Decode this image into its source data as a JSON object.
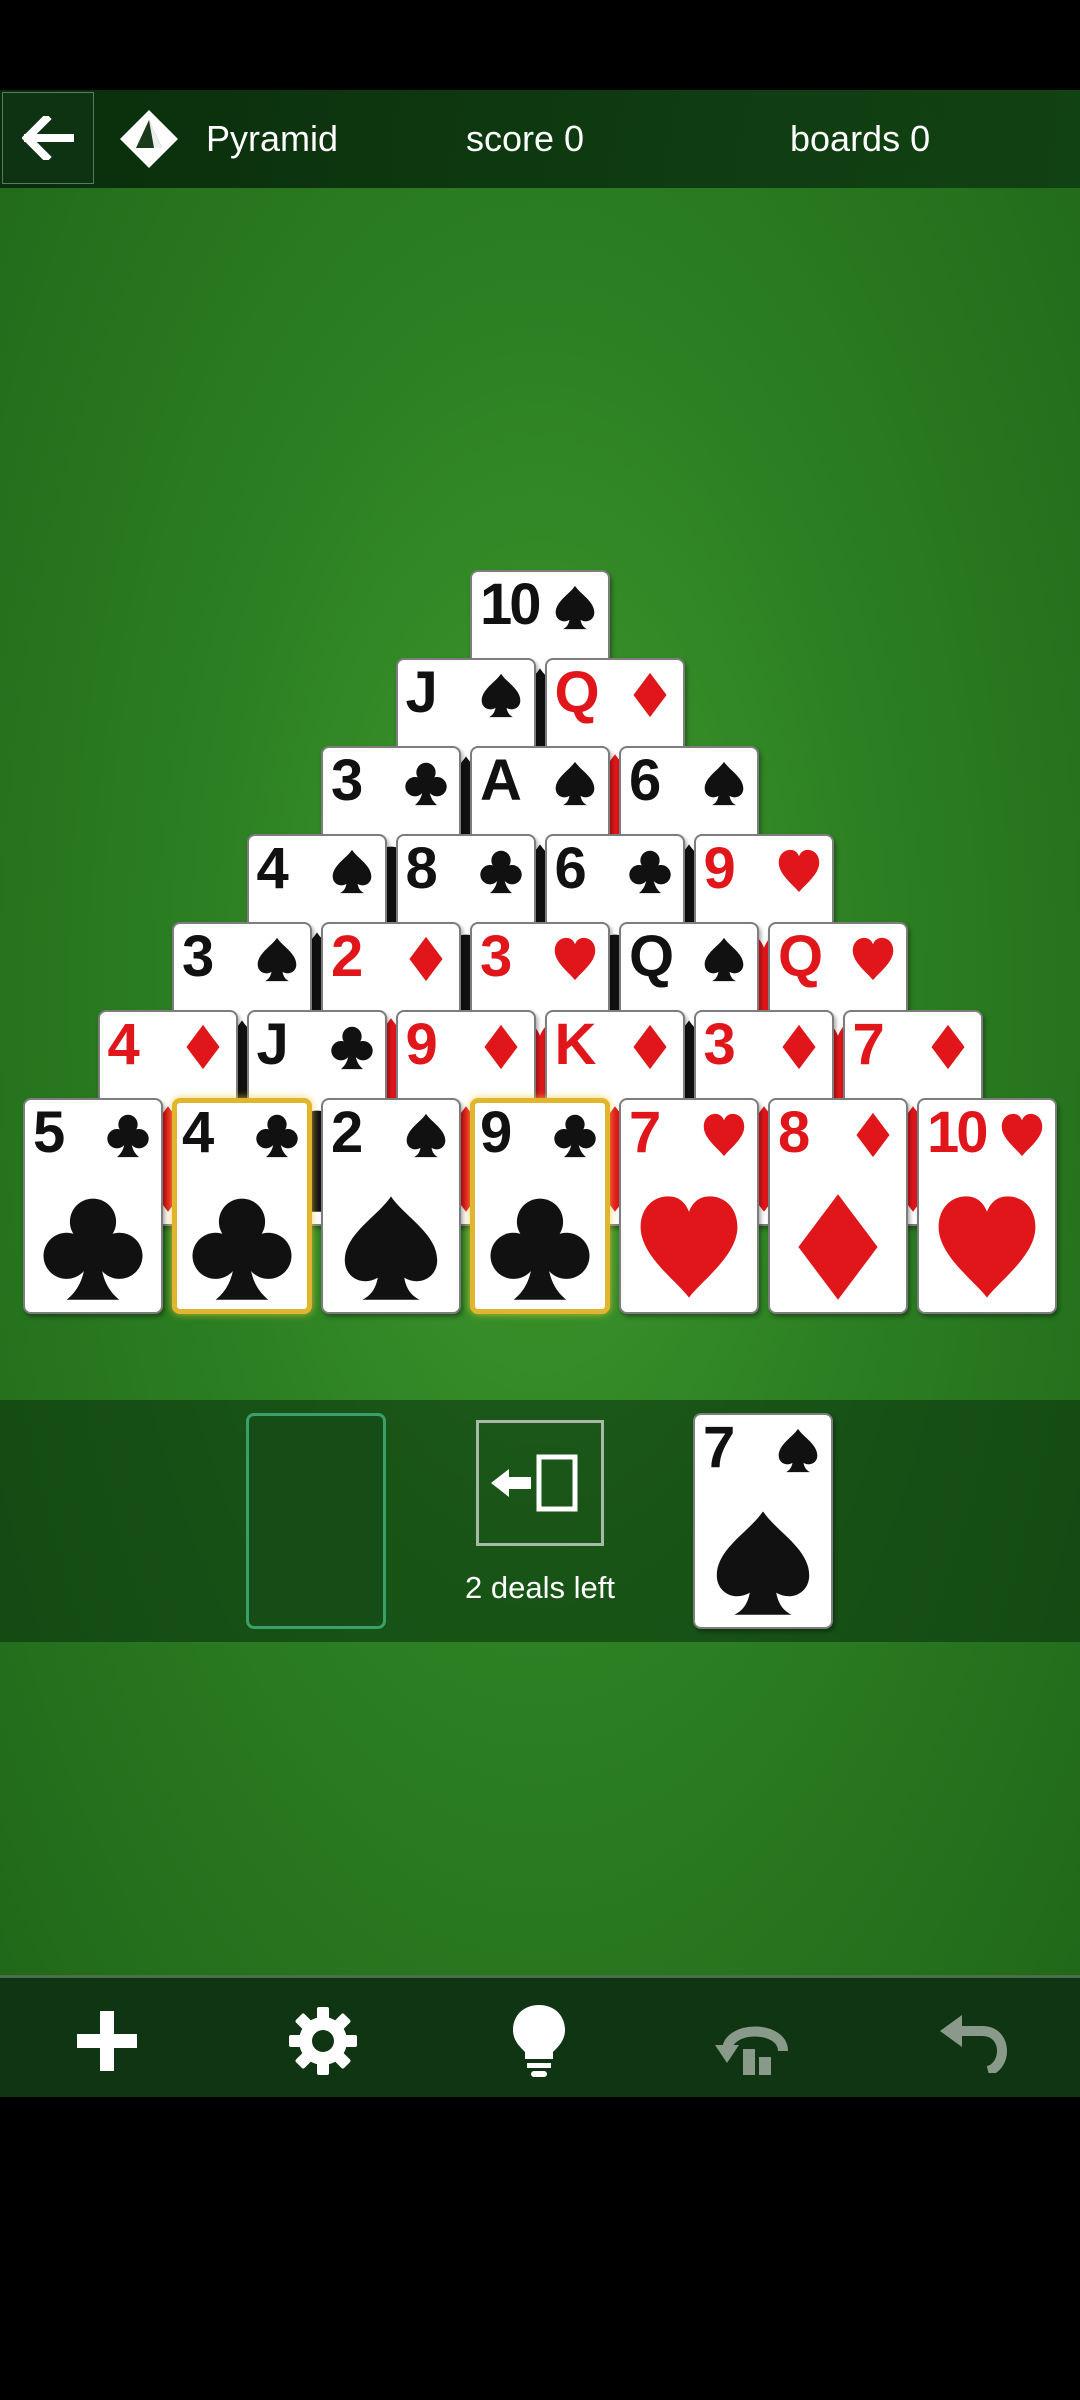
{
  "header": {
    "title": "Pyramid",
    "score": "score 0",
    "boards": "boards 0"
  },
  "colors": {
    "felt": "#2c7f22",
    "header": "#0d3313",
    "red_suit": "#e0161b",
    "black_suit": "#111111",
    "selected_border": "#e2b52f",
    "stock_outline": "#3aa06a"
  },
  "pyramid_rows": [
    [
      {
        "rank": "10",
        "suit": "spade"
      }
    ],
    [
      {
        "rank": "J",
        "suit": "spade"
      },
      {
        "rank": "Q",
        "suit": "diamond"
      }
    ],
    [
      {
        "rank": "3",
        "suit": "club"
      },
      {
        "rank": "A",
        "suit": "spade"
      },
      {
        "rank": "6",
        "suit": "spade"
      }
    ],
    [
      {
        "rank": "4",
        "suit": "spade"
      },
      {
        "rank": "8",
        "suit": "club"
      },
      {
        "rank": "6",
        "suit": "club"
      },
      {
        "rank": "9",
        "suit": "heart"
      }
    ],
    [
      {
        "rank": "3",
        "suit": "spade"
      },
      {
        "rank": "2",
        "suit": "diamond"
      },
      {
        "rank": "3",
        "suit": "heart"
      },
      {
        "rank": "Q",
        "suit": "spade"
      },
      {
        "rank": "Q",
        "suit": "heart"
      }
    ],
    [
      {
        "rank": "4",
        "suit": "diamond"
      },
      {
        "rank": "J",
        "suit": "club"
      },
      {
        "rank": "9",
        "suit": "diamond"
      },
      {
        "rank": "K",
        "suit": "diamond"
      },
      {
        "rank": "3",
        "suit": "diamond"
      },
      {
        "rank": "7",
        "suit": "diamond"
      }
    ],
    [
      {
        "rank": "5",
        "suit": "club"
      },
      {
        "rank": "4",
        "suit": "club",
        "selected": true
      },
      {
        "rank": "2",
        "suit": "spade"
      },
      {
        "rank": "9",
        "suit": "club",
        "selected": true
      },
      {
        "rank": "7",
        "suit": "heart"
      },
      {
        "rank": "8",
        "suit": "diamond"
      },
      {
        "rank": "10",
        "suit": "heart"
      }
    ]
  ],
  "waste_card": {
    "rank": "7",
    "suit": "spade"
  },
  "stock": {
    "deals_left": "2 deals left"
  },
  "toolbar": {
    "icons": [
      "plus-icon",
      "gear-icon",
      "lightbulb-icon",
      "replay-icon",
      "undo-icon"
    ]
  }
}
